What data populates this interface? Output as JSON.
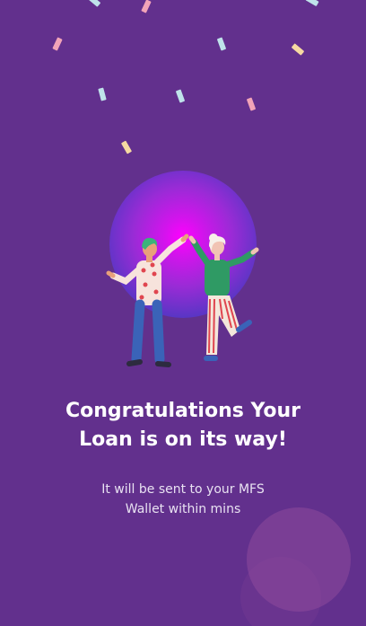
{
  "success": {
    "title_line1": "Congratulations Your",
    "title_line2": "Loan is on its way!",
    "message_line1": "It will be sent to your MFS",
    "message_line2": "Wallet within mins"
  },
  "colors": {
    "background": "#62308d",
    "glow_center": "#ff00ff",
    "glow_edge": "#3d2fb4",
    "title": "#ffffff",
    "message": "#e9e2f2"
  },
  "icons": [
    "confetti-icon",
    "celebrating-people-illustration",
    "glowing-circle",
    "decorative-circle"
  ]
}
